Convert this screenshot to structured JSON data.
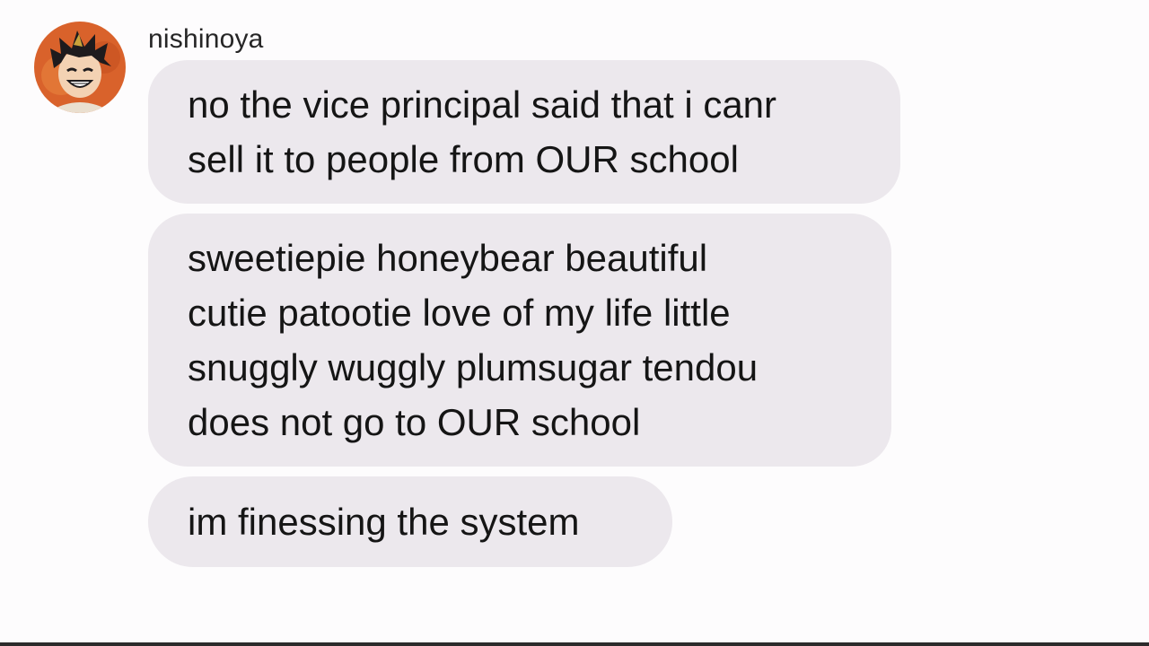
{
  "chat": {
    "sender": {
      "name": "nishinoya",
      "avatar_icon": "anime-character-avatar-icon"
    },
    "messages": [
      {
        "text": "no the vice principal said that i canr\nsell it to people from OUR school"
      },
      {
        "text": "sweetiepie honeybear beautiful\ncutie patootie love of my life little\nsnuggly wuggly plumsugar tendou\ndoes not go to OUR school"
      },
      {
        "text": "im finessing the system"
      }
    ]
  },
  "colors": {
    "background": "#fdfcfd",
    "bubble": "#ece8ed",
    "text": "#151515",
    "name": "#262626",
    "avatar_bg": "#d9622b"
  }
}
